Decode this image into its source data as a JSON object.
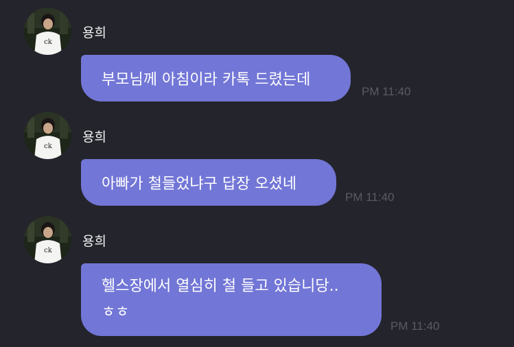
{
  "messages": [
    {
      "sender": "용희",
      "lines": [
        "부모님께 아침이라 카톡 드렸는데"
      ],
      "time": "PM 11:40"
    },
    {
      "sender": "용희",
      "lines": [
        "아빠가 철들었냐구 답장 오셨네"
      ],
      "time": "PM 11:40"
    },
    {
      "sender": "용희",
      "lines": [
        "헬스장에서 열심히 철 들고 있습니당..",
        "ㅎㅎ"
      ],
      "time": "PM 11:40"
    }
  ],
  "colors": {
    "background": "#24242c",
    "bubble": "#7276d6",
    "time": "#5b5b66",
    "name": "#f2f2f4"
  }
}
